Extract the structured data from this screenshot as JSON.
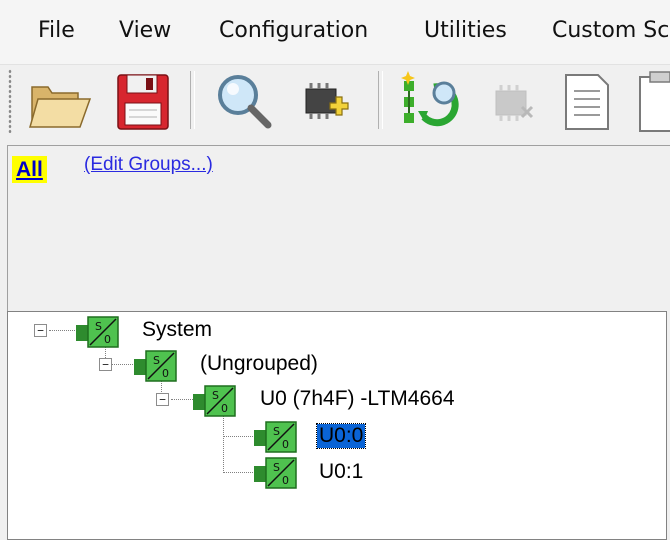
{
  "menu": {
    "items": [
      "File",
      "View",
      "Configuration",
      "Utilities",
      "Custom Sc"
    ]
  },
  "toolbar": {
    "buttons": [
      {
        "icon": "folder-open-icon"
      },
      {
        "icon": "floppy-disk-save-icon"
      },
      {
        "icon": "magnifier-search-icon"
      },
      {
        "icon": "add-device-chip-icon"
      },
      {
        "icon": "network-refresh-icon"
      },
      {
        "icon": "remove-device-chip-icon",
        "disabled": true
      },
      {
        "icon": "document-icon"
      },
      {
        "icon": "clipboard-icon"
      }
    ]
  },
  "groups": {
    "all_label": "All",
    "edit_link": "(Edit Groups...)",
    "all_highlight_color": "#ffff00"
  },
  "tree": {
    "nodes": [
      {
        "label": "System",
        "level": 0,
        "expanded": true
      },
      {
        "label": "(Ungrouped)",
        "level": 1,
        "expanded": true
      },
      {
        "label": "U0 (7h4F) -LTM4664",
        "level": 2,
        "expanded": true
      },
      {
        "label": "U0:0",
        "level": 3,
        "selected": true
      },
      {
        "label": "U0:1",
        "level": 3
      }
    ],
    "icon": "power-converter-icon",
    "icon_glyph": "S/0",
    "selection_color": "#0a64d6"
  }
}
